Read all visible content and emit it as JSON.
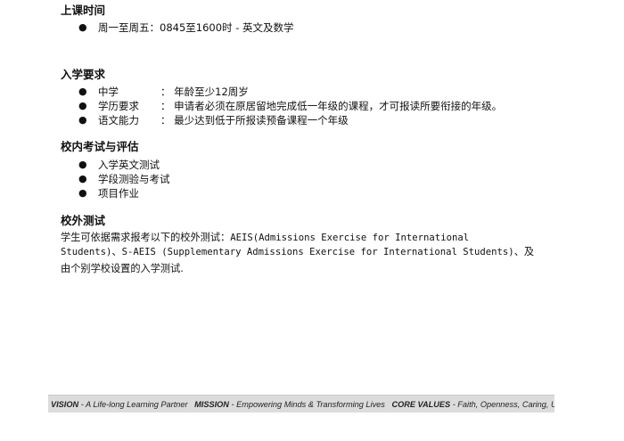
{
  "schedule": {
    "heading": "上课时间",
    "items": [
      "周一至周五：0845至1600时 - 英文及数学"
    ]
  },
  "requirements": {
    "heading": "入学要求",
    "items": [
      {
        "label": "中学",
        "sep": "：",
        "value": "年龄至少12周岁"
      },
      {
        "label": "学历要求",
        "sep": "：",
        "value": "申请者必须在原居留地完成低一年级的课程，才可报读所要衔接的年级。"
      },
      {
        "label": "语文能力",
        "sep": "：",
        "value": "最少达到低于所报读预备课程一个年级"
      }
    ]
  },
  "assessment": {
    "heading": "校内考试与评估",
    "items": [
      "入学英文测试",
      "学段测验与考试",
      "项目作业"
    ]
  },
  "external": {
    "heading": "校外测试",
    "line1_a": "学生可依据需求报考以下的校外测试：",
    "line1_b": "AEIS(Admissions Exercise for International",
    "line2_a": "Students)",
    "line2_b": "、",
    "line2_c": "S-AEIS (Supplementary Admissions Exercise for International Students)",
    "line2_d": "、及",
    "line3": "由个别学校设置的入学测试."
  },
  "footer": {
    "vision_label": "VISION",
    "vision_text": " - A Life-long Learning Partner",
    "mission_label": "MISSION",
    "mission_text": " - Empowering Minds & Transforming Lives",
    "values_label": "CORE VALUES",
    "values_text": " - Faith, Openness, Caring, Unity, Sharing"
  }
}
